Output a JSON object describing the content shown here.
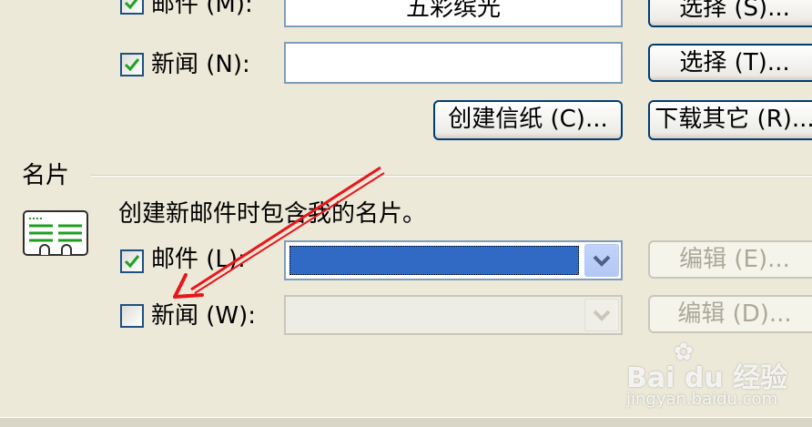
{
  "news_section": {
    "mail_row": {
      "checked": true,
      "label": "邮件 (M):",
      "stationery_value": "五彩缤光",
      "select_button": "选择 (S)..."
    },
    "news_row": {
      "checked": true,
      "label": "新闻 (N):",
      "stationery_value": "",
      "select_button": "选择 (T)..."
    },
    "create_stationery_button": "创建信纸 (C)...",
    "download_more_button": "下载其它 (R)..."
  },
  "business_card": {
    "group_title": "名片",
    "description": "创建新邮件时包含我的名片。",
    "mail_row": {
      "checked": true,
      "label": "邮件 (L):",
      "edit_button": "编辑 (E)..."
    },
    "news_row": {
      "checked": false,
      "label": "新闻 (W):",
      "edit_button": "编辑 (D)..."
    }
  },
  "watermark": {
    "brand": "Bai du 经验",
    "url": "jingyan.baidu.com"
  },
  "colors": {
    "dialog_bg": "#ECE9D8",
    "selection": "#316AC5",
    "annotation_arrow": "#E8161B"
  }
}
